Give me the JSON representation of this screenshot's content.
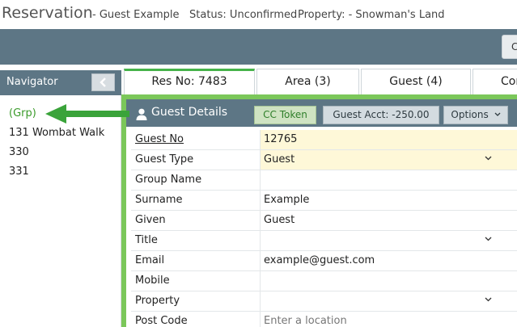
{
  "header": {
    "title": "Reservation",
    "guest": "- Guest Example",
    "status": "Status: Unconfirmed",
    "property": "Property: - Snowman's Land"
  },
  "toolbar": {
    "button_label": "C"
  },
  "navigator": {
    "title": "Navigator",
    "items": [
      "(Grp)",
      "131 Wombat Walk",
      "330",
      "331"
    ]
  },
  "tabs": [
    {
      "label": "Res No: 7483"
    },
    {
      "label": "Area (3)"
    },
    {
      "label": "Guest (4)"
    },
    {
      "label": "Con"
    }
  ],
  "guest_details": {
    "title": "Guest Details",
    "cc_token_label": "CC Token",
    "guest_acct_label": "Guest Acct: -250.00",
    "options_label": "Options",
    "fields": [
      {
        "label": "Guest No",
        "value": "12765"
      },
      {
        "label": "Guest Type",
        "value": "Guest"
      },
      {
        "label": "Group Name",
        "value": ""
      },
      {
        "label": "Surname",
        "value": "Example"
      },
      {
        "label": "Given",
        "value": "Guest"
      },
      {
        "label": "Title",
        "value": ""
      },
      {
        "label": "Email",
        "value": "example@guest.com"
      },
      {
        "label": "Mobile",
        "value": ""
      },
      {
        "label": "Property",
        "value": ""
      },
      {
        "label": "Post Code",
        "value": "",
        "placeholder": "Enter a location"
      }
    ]
  },
  "colors": {
    "header_bg": "#5d7685",
    "accent_green": "#46b34a",
    "highlight": "#fef8d8"
  }
}
